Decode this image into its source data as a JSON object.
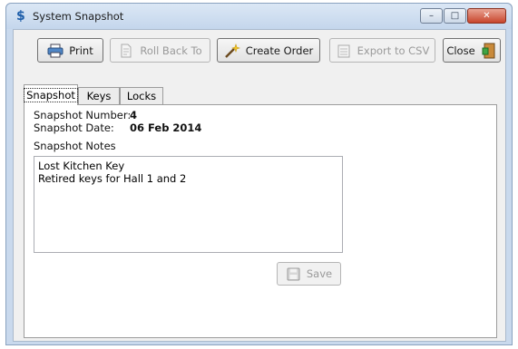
{
  "window": {
    "title": "System Snapshot",
    "minimize": "–",
    "maximize": "□",
    "close": "✕"
  },
  "toolbar": {
    "print_label": "Print",
    "rollback_label": "Roll Back To",
    "create_order_label": "Create Order",
    "export_label": "Export to CSV",
    "close_label": "Close"
  },
  "tabs": [
    {
      "label": "Snapshot"
    },
    {
      "label": "Keys"
    },
    {
      "label": "Locks"
    }
  ],
  "snapshot": {
    "number_label": "Snapshot Number:",
    "number_value": "4",
    "date_label": "Snapshot Date:",
    "date_value": "06 Feb 2014",
    "notes_label": "Snapshot Notes",
    "notes_value": "Lost Kitchen Key\nRetired keys for Hall 1 and 2",
    "save_label": "Save"
  }
}
